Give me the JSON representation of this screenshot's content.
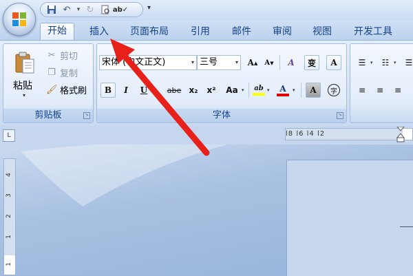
{
  "quick_access": {
    "save_icon": "save-icon",
    "undo_icon": "undo-icon",
    "redo_icon": "redo-icon",
    "print_icon": "print-preview-icon",
    "spell_icon": "spell-check-icon"
  },
  "tabs": [
    {
      "label": "开始",
      "active": true
    },
    {
      "label": "插入"
    },
    {
      "label": "页面布局"
    },
    {
      "label": "引用"
    },
    {
      "label": "邮件"
    },
    {
      "label": "审阅"
    },
    {
      "label": "视图"
    },
    {
      "label": "开发工具"
    }
  ],
  "clipboard": {
    "paste_label": "粘贴",
    "cut_label": "剪切",
    "copy_label": "复制",
    "format_painter_label": "格式刷",
    "group_label": "剪贴板"
  },
  "font": {
    "font_name": "宋体 (中文正文)",
    "font_size": "三号",
    "grow": "A",
    "shrink": "A",
    "clear": "A",
    "phonetic": "变",
    "border": "A",
    "bold": "B",
    "italic": "I",
    "underline": "U",
    "strike": "abe",
    "subscript": "x₂",
    "superscript": "x²",
    "case": "Aa",
    "highlight": "ab",
    "color": "A",
    "shading": "A",
    "enclose": "字",
    "group_label": "字体",
    "highlight_color": "#ffff00",
    "font_color": "#e00000"
  },
  "ruler": {
    "tab_stop": "L",
    "h_ticks": "l8 l6 l4 l2",
    "v_ticks": [
      "4",
      "3",
      "2",
      "1",
      "1"
    ]
  },
  "annotation": {
    "arrow_color": "#e8201a"
  }
}
